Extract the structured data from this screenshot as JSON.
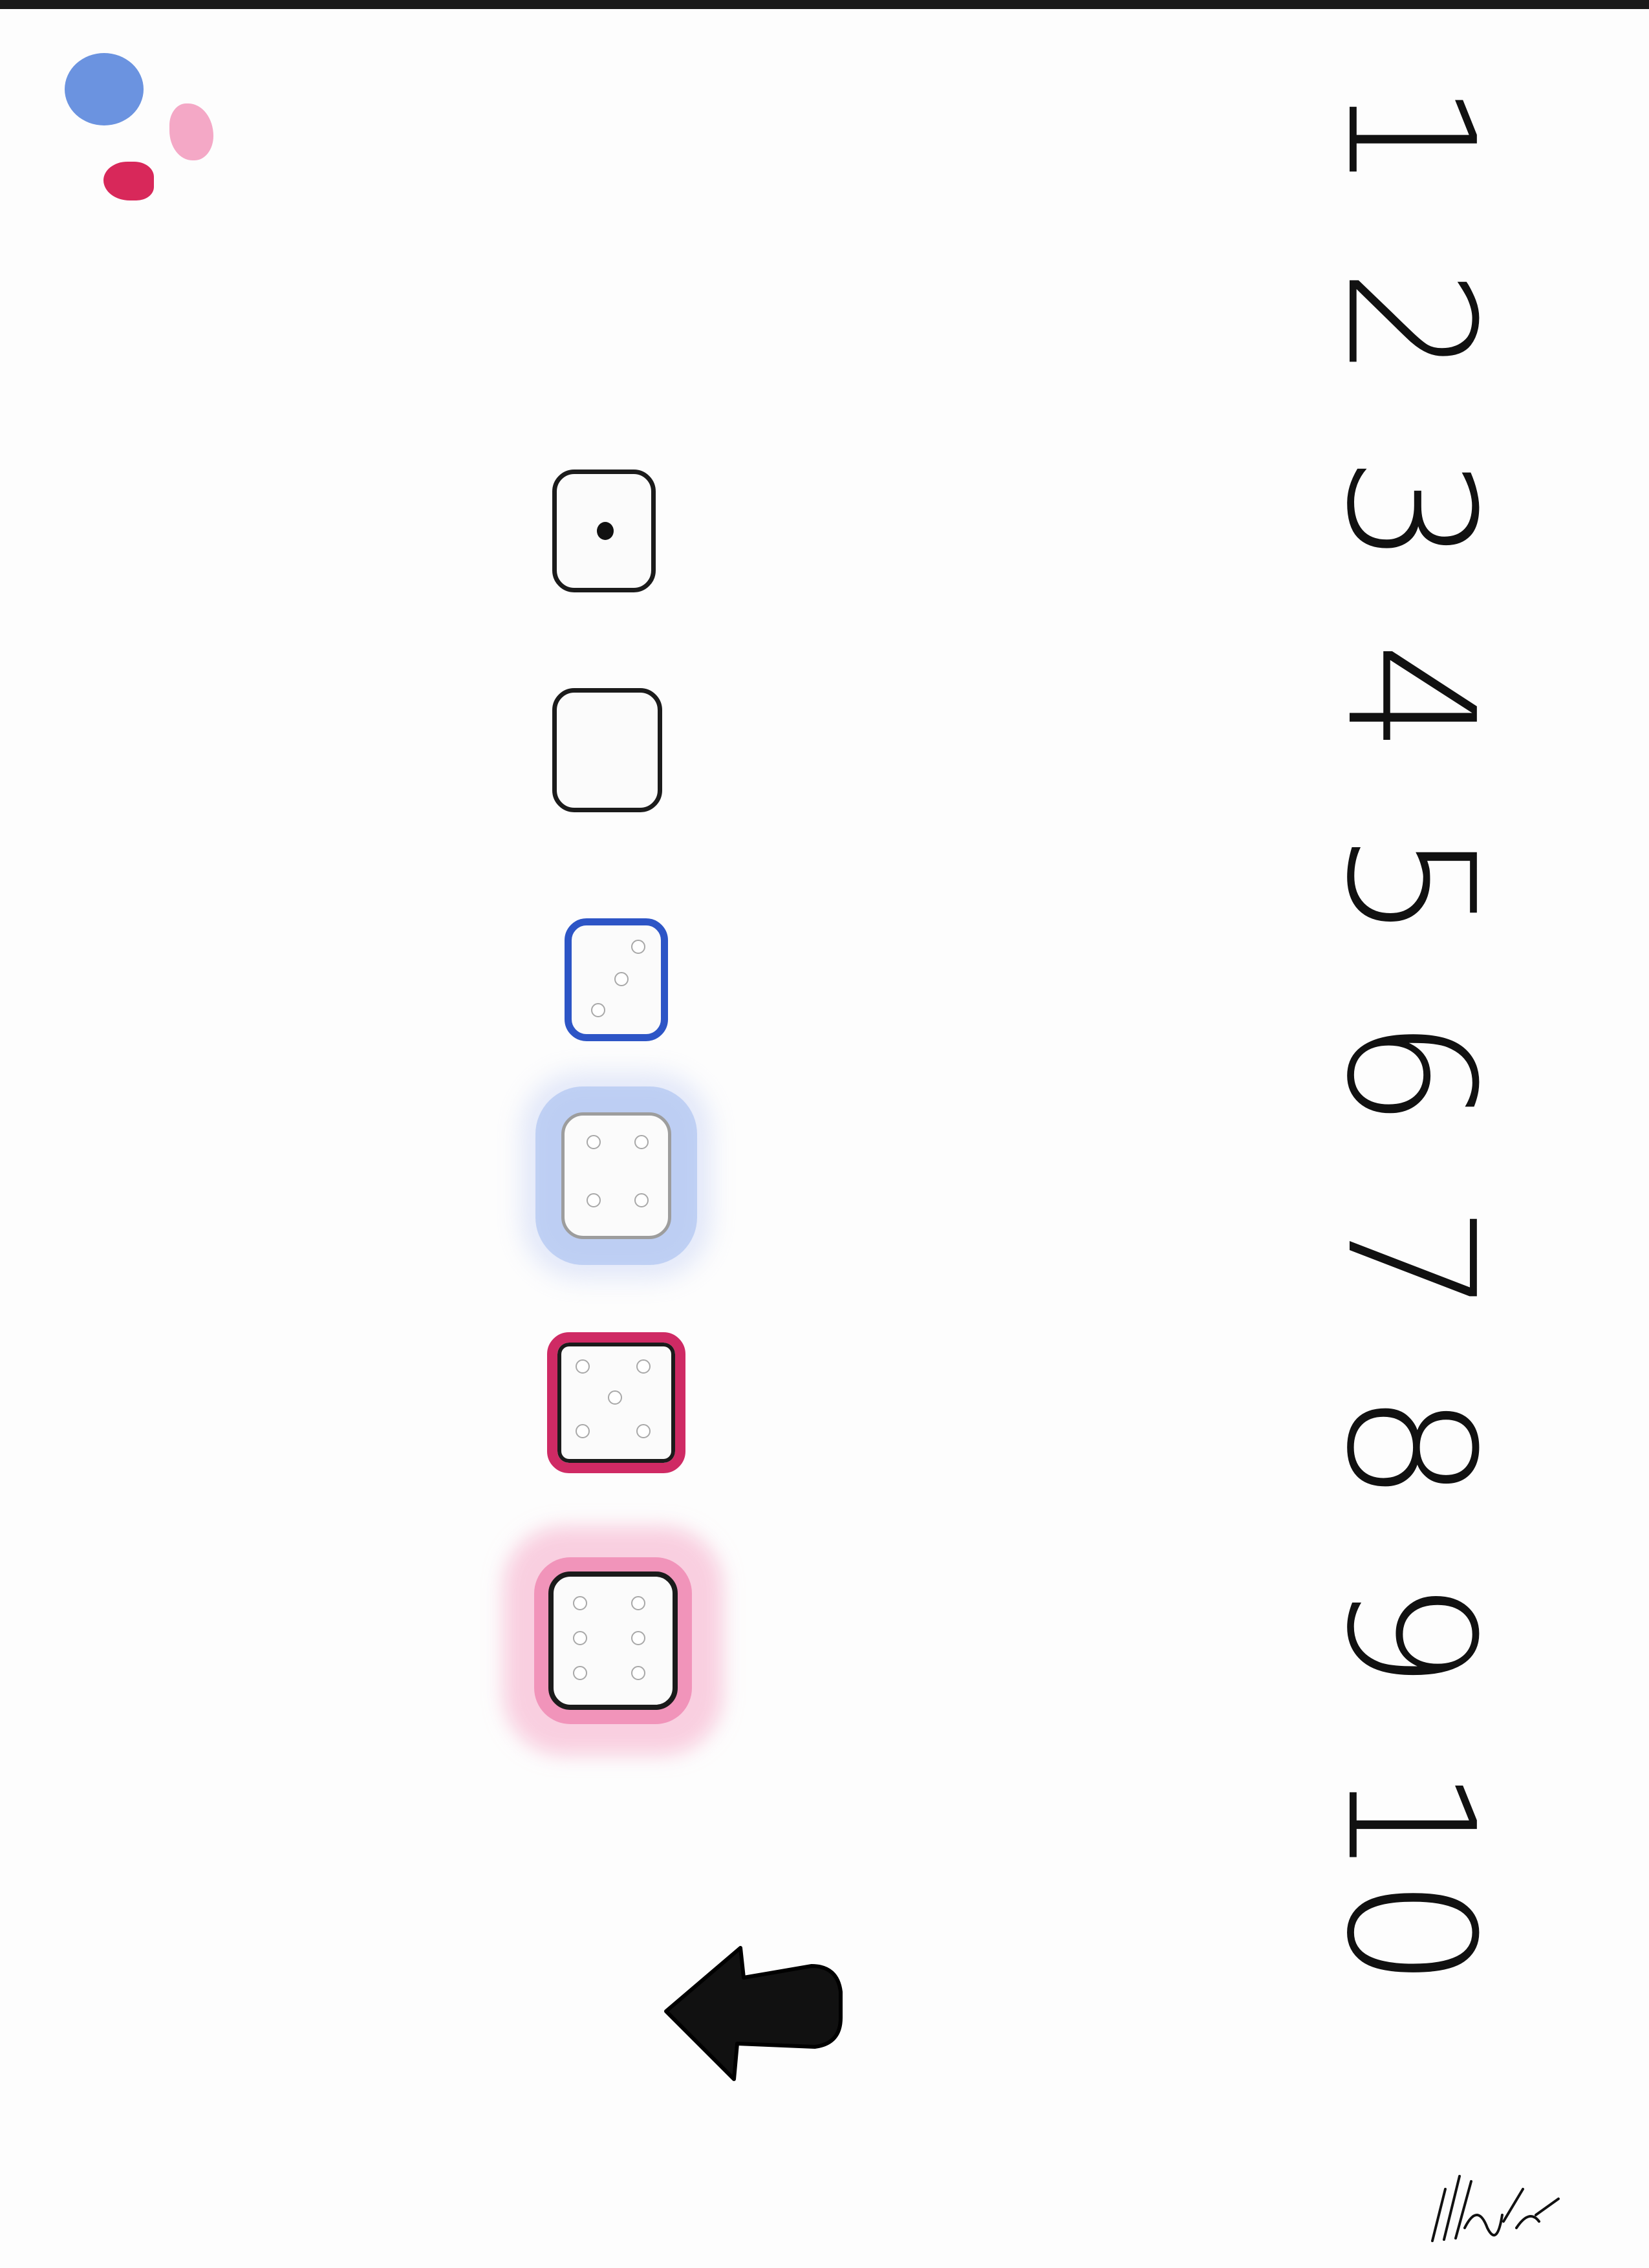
{
  "numbers": [
    "1",
    "2",
    "3",
    "4",
    "5",
    "6",
    "7",
    "8",
    "9",
    "10"
  ],
  "paint_swatches": [
    {
      "name": "blue",
      "color": "#6b93e0"
    },
    {
      "name": "pink",
      "color": "#f4a8c6"
    },
    {
      "name": "red",
      "color": "#d8285a"
    }
  ],
  "dice": [
    {
      "face": 1,
      "border_color": "#1b1b1b",
      "highlight": "none"
    },
    {
      "face": 0,
      "border_color": "#1b1b1b",
      "highlight": "none"
    },
    {
      "face": 3,
      "border_color": "#2d55c6",
      "highlight": "none"
    },
    {
      "face": 4,
      "border_color": "#9d9d9d",
      "highlight": "#a9c0ee"
    },
    {
      "face": 5,
      "border_color": "#cf2a64",
      "highlight": "none"
    },
    {
      "face": 6,
      "border_color": "#1b1b1b",
      "highlight": "#f194ba"
    }
  ],
  "back_arrow": {
    "icon": "arrow-left-icon",
    "color": "#111111"
  }
}
